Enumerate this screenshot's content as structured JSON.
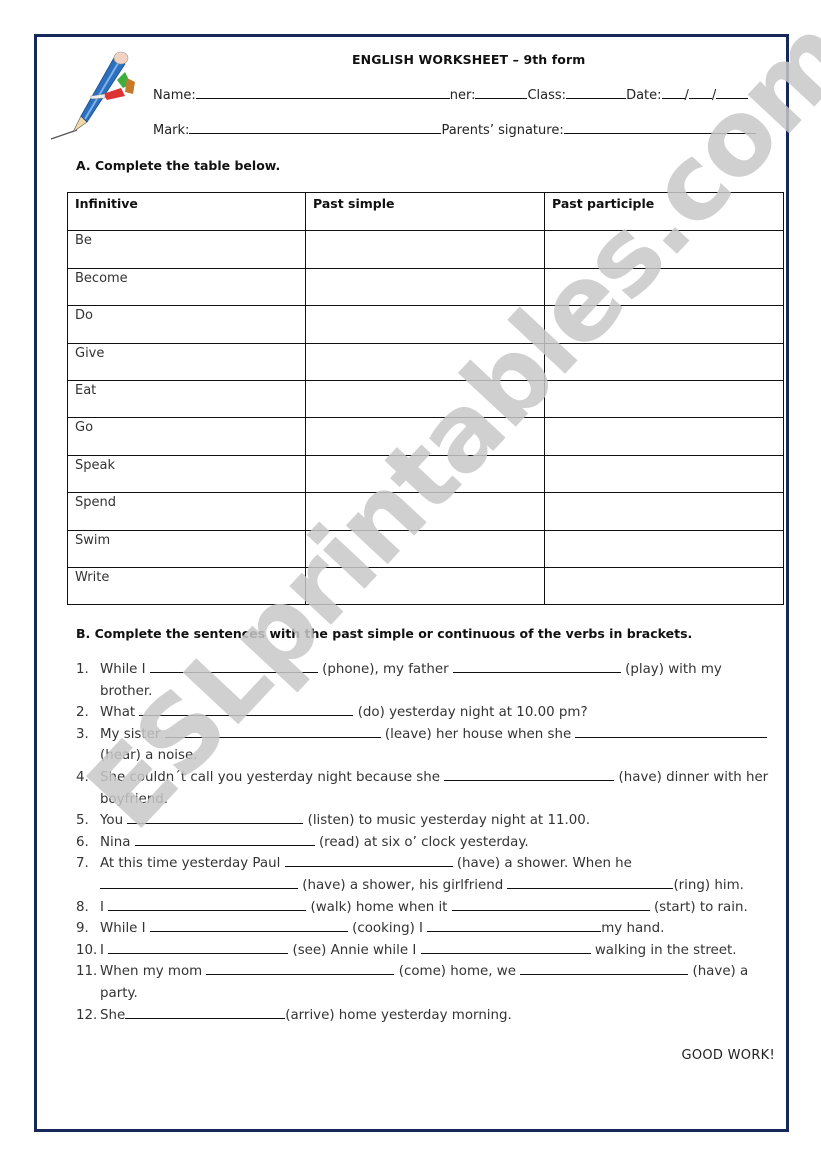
{
  "header": {
    "title": "ENGLISH WORKSHEET – 9th form",
    "fields_row1": [
      {
        "label": "Name:"
      },
      {
        "label": "ner:"
      },
      {
        "label": "Class:"
      },
      {
        "label": "Date:"
      }
    ],
    "date_separator": "/",
    "fields_row2": [
      {
        "label": "Mark:"
      },
      {
        "label": "Parents’ signature:"
      }
    ]
  },
  "section_a": {
    "title": "A. Complete the table below.",
    "columns": [
      "Infinitive",
      "Past simple",
      "Past participle"
    ],
    "rows": [
      {
        "infinitive": "Be",
        "past_simple": "",
        "past_participle": ""
      },
      {
        "infinitive": "Become",
        "past_simple": "",
        "past_participle": ""
      },
      {
        "infinitive": "Do",
        "past_simple": "",
        "past_participle": ""
      },
      {
        "infinitive": "Give",
        "past_simple": "",
        "past_participle": ""
      },
      {
        "infinitive": "Eat",
        "past_simple": "",
        "past_participle": ""
      },
      {
        "infinitive": "Go",
        "past_simple": "",
        "past_participle": ""
      },
      {
        "infinitive": "Speak",
        "past_simple": "",
        "past_participle": ""
      },
      {
        "infinitive": "Spend",
        "past_simple": "",
        "past_participle": ""
      },
      {
        "infinitive": "Swim",
        "past_simple": "",
        "past_participle": ""
      },
      {
        "infinitive": "Write",
        "past_simple": "",
        "past_participle": ""
      }
    ]
  },
  "section_b": {
    "title": "B. Complete the sentences with the past simple or continuous of the verbs in brackets.",
    "items": [
      {
        "num": "1.",
        "parts": [
          "While I ",
          "__",
          " (phone), my father ",
          "__",
          " (play) with my brother."
        ]
      },
      {
        "num": "2.",
        "parts": [
          "What ",
          "__",
          " (do) yesterday night at 10.00 pm?"
        ]
      },
      {
        "num": "3.",
        "parts": [
          "My sister ",
          "__",
          " (leave) her house when she ",
          "__",
          " (hear) a noise."
        ]
      },
      {
        "num": "4.",
        "parts": [
          "She couldn´t call you yesterday night because she ",
          "__",
          " (have) dinner with her boyfriend."
        ]
      },
      {
        "num": "5.",
        "parts": [
          "You ",
          "__",
          " (listen) to music yesterday night at 11.00."
        ]
      },
      {
        "num": "6.",
        "parts": [
          "Nina ",
          "__",
          " (read) at six o’ clock yesterday."
        ]
      },
      {
        "num": "7.",
        "parts": [
          "At this time yesterday Paul ",
          "__",
          " (have) a shower. When he ",
          "__",
          " (have) a shower, his girlfriend ",
          "__",
          "(ring) him."
        ]
      },
      {
        "num": "8.",
        "parts": [
          "I ",
          "__",
          " (walk) home when it ",
          "__",
          " (start) to rain."
        ]
      },
      {
        "num": "9.",
        "parts": [
          "While I ",
          "__",
          " (cooking) I ",
          "__",
          "my hand."
        ]
      },
      {
        "num": "10.",
        "parts": [
          "I ",
          "__",
          " (see) Annie while I ",
          "__",
          " walking in the street."
        ]
      },
      {
        "num": "11.",
        "parts": [
          "When my mom ",
          "__",
          " (come) home, we ",
          "__",
          " (have) a party."
        ]
      },
      {
        "num": "12.",
        "parts": [
          "She",
          "__",
          "(arrive) home yesterday morning."
        ]
      }
    ]
  },
  "footer": {
    "closing": "GOOD WORK!"
  },
  "watermark": {
    "text": "ESLprintables.com"
  },
  "colors": {
    "frame": "#14285a",
    "watermark": "#c8c8c8"
  }
}
